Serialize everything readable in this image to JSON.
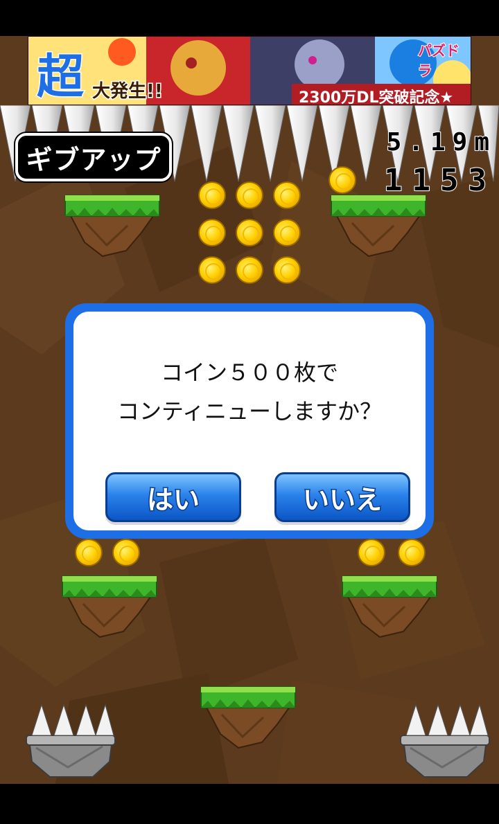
{
  "ad": {
    "badge_big": "超",
    "badge_small": "大発生!!",
    "brand": "パズドラ",
    "caption": "2300万DL突破記念★"
  },
  "hud": {
    "giveup_label": "ギブアップ",
    "distance": "5.19m",
    "score": "1153"
  },
  "dialog": {
    "line1": "コイン５００枚で",
    "line2": "コンティニューしますか？",
    "yes_label": "はい",
    "no_label": "いいえ"
  },
  "colors": {
    "cave": "#5b3a1e",
    "dialog_border": "#1e6fe6",
    "button_blue": "#2a82ea",
    "grass": "#3fb52b",
    "coin": "#ffd000"
  }
}
